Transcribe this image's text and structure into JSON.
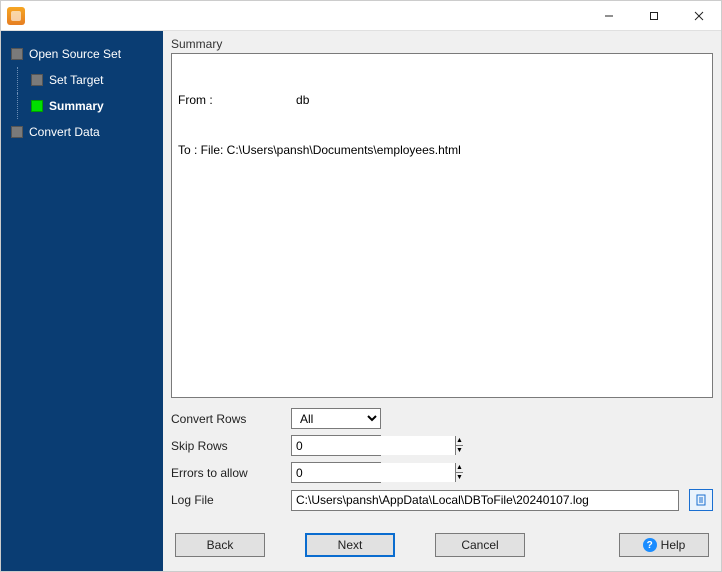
{
  "titlebar": {
    "min_tooltip": "Minimize",
    "max_tooltip": "Maximize",
    "close_tooltip": "Close"
  },
  "sidebar": {
    "steps": [
      {
        "label": "Open Source Set",
        "indent": 0,
        "current": false
      },
      {
        "label": "Set Target",
        "indent": 1,
        "current": false
      },
      {
        "label": "Summary",
        "indent": 1,
        "current": true
      },
      {
        "label": "Convert Data",
        "indent": 0,
        "current": false
      }
    ]
  },
  "main": {
    "panel_title": "Summary",
    "summary_from_label": "From :",
    "summary_from_value": "db",
    "summary_to": "To : File: C:\\Users\\pansh\\Documents\\employees.html",
    "form": {
      "convert_rows_label": "Convert Rows",
      "convert_rows_value": "All",
      "skip_rows_label": "Skip Rows",
      "skip_rows_value": "0",
      "errors_label": "Errors to allow",
      "errors_value": "0",
      "log_label": "Log File",
      "log_value": "C:\\Users\\pansh\\AppData\\Local\\DBToFile\\20240107.log"
    }
  },
  "buttons": {
    "back": "Back",
    "next": "Next",
    "cancel": "Cancel",
    "help": "Help"
  }
}
